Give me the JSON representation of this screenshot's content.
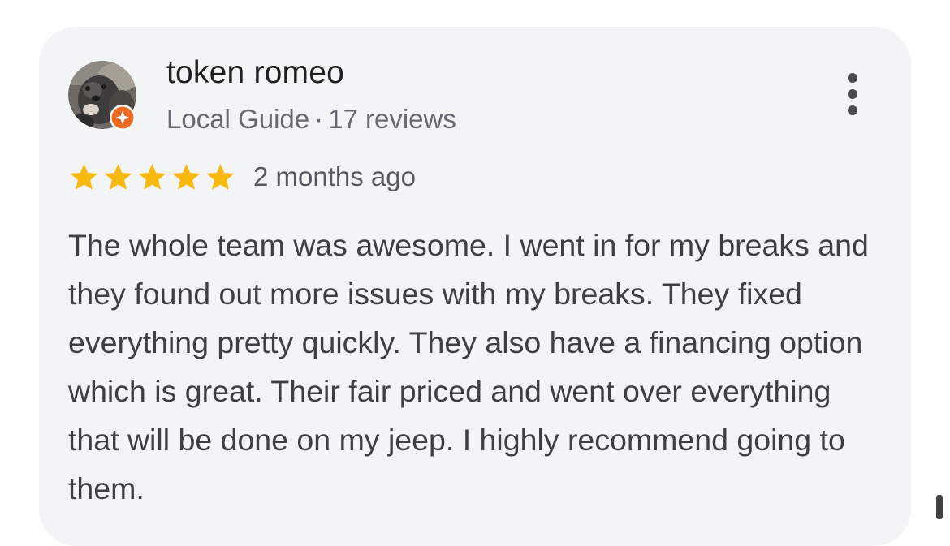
{
  "review": {
    "author_name": "token romeo",
    "author_badge": "Local Guide",
    "meta_separator": "·",
    "review_count": "17 reviews",
    "rating": 5,
    "rating_max": 5,
    "time": "2 months ago",
    "text": "The whole team was awesome. I went in for my breaks and they found out more issues with my breaks. They fixed everything pretty quickly. They also have a financing option which is great. Their fair priced and went over everything that will be done on my jeep. I highly recommend going to them."
  },
  "icons": {
    "avatar": "avatar",
    "badge": "local-guide-badge-icon",
    "star": "star-icon",
    "more": "more-vert-icon"
  },
  "colors": {
    "card_background": "#f3f4f6",
    "star": "#f8b90d",
    "badge": "#ee6a22",
    "name": "#1f1f1f",
    "meta": "#666a70",
    "body_text": "#3c3f44"
  }
}
